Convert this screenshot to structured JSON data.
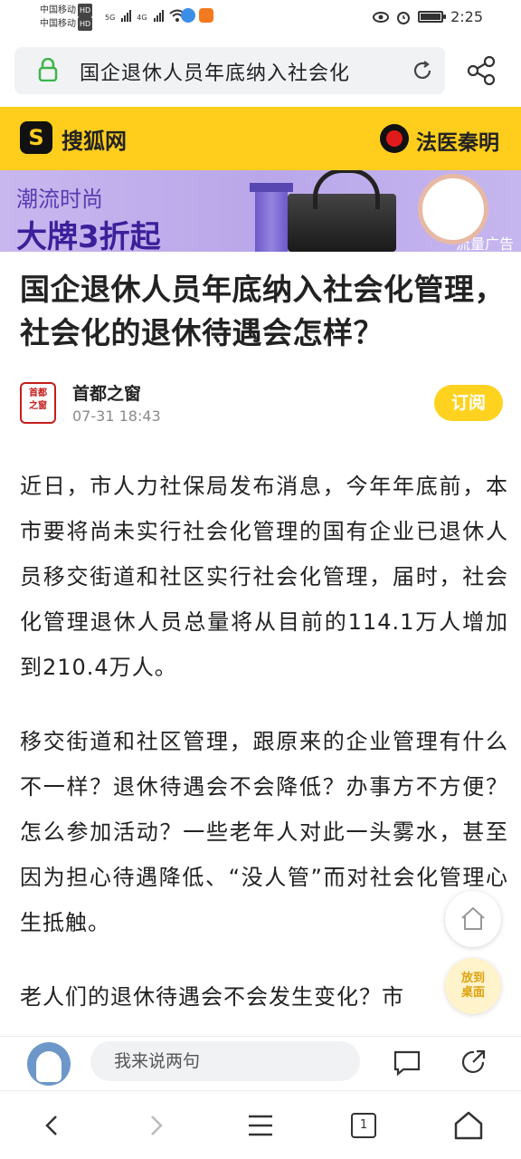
{
  "status_bar": {
    "carrier1": "中国移动",
    "carrier2": "中国移动",
    "hd1": "HD",
    "hd2": "HD",
    "net1": "5G",
    "net2": "4G",
    "time": "2:25",
    "battery_level": 0.9
  },
  "address_bar": {
    "url_text": "国企退休人员年底纳入社会化"
  },
  "site_header": {
    "site_name": "搜狐网",
    "logo_letter": "S",
    "promo_text": "法医秦明"
  },
  "ad": {
    "subtitle": "潮流时尚",
    "headline": "大牌3折起",
    "tag": "流量广告"
  },
  "article": {
    "title": "国企退休人员年底纳入社会化管理，社会化的退休待遇会怎样？",
    "author": "首都之窗",
    "publish_time": "07-31 18:43",
    "subscribe_label": "订阅",
    "paragraphs": [
      "近日，市人力社保局发布消息，今年年底前，本市要将尚未实行社会化管理的国有企业已退休人员移交街道和社区实行社会化管理，届时，社会化管理退休人员总量将从目前的114.1万人增加到210.4万人。",
      "移交街道和社区管理，跟原来的企业管理有什么不一样？退休待遇会不会降低？办事方不方便？怎么参加活动？一些老年人对此一头雾水，甚至因为担心待遇降低、“没人管”而对社会化管理心生抵触。",
      "老人们的退休待遇会不会发生变化？市"
    ]
  },
  "floating": {
    "desk_label_1": "放到",
    "desk_label_2": "桌面"
  },
  "comment_bar": {
    "placeholder": "我来说两句"
  },
  "bottom_nav": {
    "tab_count": "1"
  },
  "colors": {
    "brand_yellow": "#ffce1d",
    "ad_purple": "#b9a7ea",
    "lock_green": "#3cb44a"
  }
}
